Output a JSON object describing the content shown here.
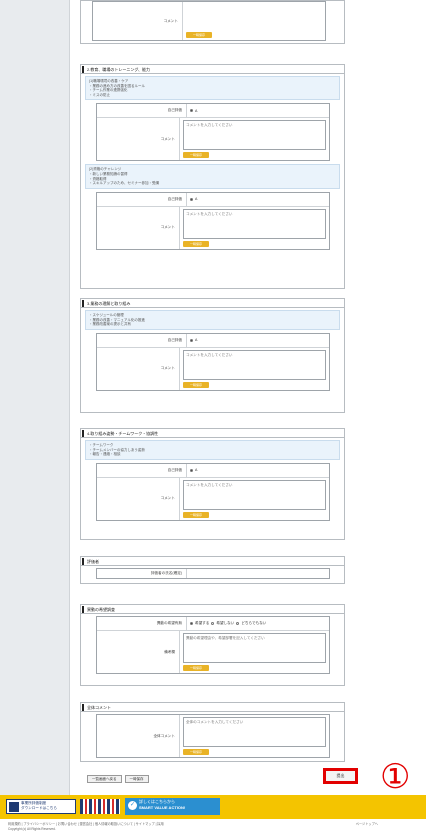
{
  "sections": {
    "top_partial": {
      "label_comment": "コメント",
      "save": "一時保存"
    },
    "s1": {
      "title": "2.教育、職場のトレーニング、能力",
      "desc1": [
        "(1)職場環境の改善・ケア",
        "・業務の進め方の改善を図るルール",
        "・チーム作業の連携強化",
        "・ミスの防止"
      ],
      "self_eval_label": "自己評価",
      "self_eval_value": "A",
      "comment_label": "コメント",
      "placeholder": "コメントを入力してください",
      "save": "一時保存",
      "desc2": [
        "(2)資格のチャレンジ",
        "・新しい業務知識の習得",
        "・資格取得",
        "・スキルアップのため、セミナー参加・受講"
      ]
    },
    "s2": {
      "title": "3.業務の理解と取り組み",
      "desc": [
        "・スケジュールの管理",
        "・業務の改善・マニュアル化の推進",
        "・業務改善案の提示と共有"
      ],
      "self_eval_label": "自己評価",
      "self_eval_value": "A",
      "comment_label": "コメント",
      "placeholder": "コメントを入力してください",
      "save": "一時保存"
    },
    "s3": {
      "title": "4.取り組み姿勢・チームワーク・協調性",
      "desc": [
        "・チームワーク",
        "・チームメンバーの協力しあう姿勢",
        "・報告・連絡・相談"
      ],
      "self_eval_label": "自己評価",
      "self_eval_value": "A",
      "comment_label": "コメント",
      "placeholder": "コメントを入力してください",
      "save": "一時保存"
    },
    "s4": {
      "title": "評価者",
      "label": "評価者の氏名(確定)"
    },
    "s5": {
      "title": "異動の希望調査",
      "hope_label": "異動の希望有無",
      "options": [
        "希望する",
        "希望しない",
        "どちらでもない"
      ],
      "note_label": "備考欄",
      "placeholder": "異動の希望理由や、希望部署を記入してください",
      "save": "一時保存"
    },
    "s6": {
      "title": "全体コメント",
      "label": "全体コメント",
      "placeholder": "全体のコメントを入力してください",
      "save": "一時保存"
    }
  },
  "actions": {
    "back": "一覧画面へ戻る",
    "draft": "一時保存",
    "submit": "提出",
    "marker": "①"
  },
  "footer": {
    "logo_text1": "事業所評価制度",
    "logo_text2": "ダウンロードはこちら",
    "banner_line1": "詳しくはこちらから",
    "banner_line2": "SMART VALUE ACTION!",
    "banner_icon": "✓",
    "links": "利用規約 | プライバシーポリシー | お問い合わせ | 運営会社 | 個人情報の取扱いについて | サイトマップ | 採用",
    "copyright": "Copyright (c) All Rights Reserved.",
    "right_text": "ページトップへ"
  },
  "colors": {
    "accent_save": "#e9b327",
    "marker_red": "#e20000",
    "footer_yellow": "#f4c400",
    "banner_blue": "#2b8fd0"
  }
}
